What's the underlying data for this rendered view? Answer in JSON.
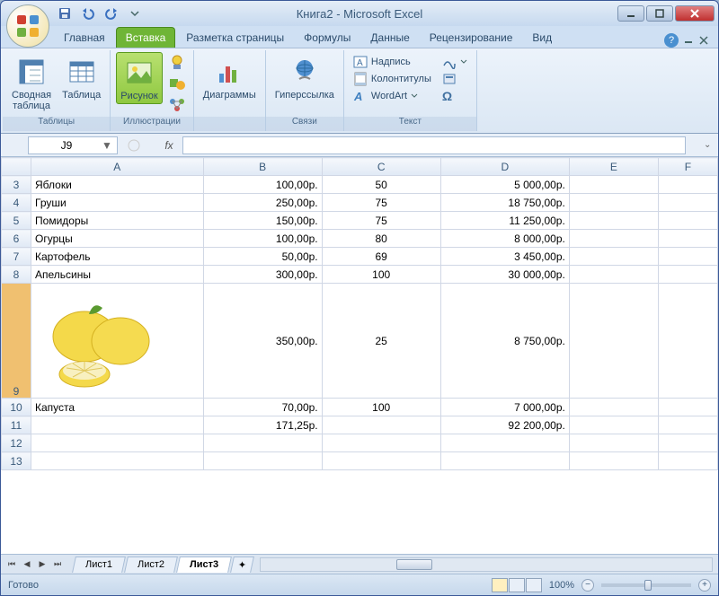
{
  "title": "Книга2 - Microsoft Excel",
  "tabs": {
    "t0": "Главная",
    "t1": "Вставка",
    "t2": "Разметка страницы",
    "t3": "Формулы",
    "t4": "Данные",
    "t5": "Рецензирование",
    "t6": "Вид"
  },
  "ribbon": {
    "pivot": "Сводная\nтаблица",
    "table": "Таблица",
    "picture": "Рисунок",
    "charts": "Диаграммы",
    "hyperlink": "Гиперссылка",
    "textbox": "Надпись",
    "headerfooter": "Колонтитулы",
    "wordart": "WordArt",
    "grp_tables": "Таблицы",
    "grp_illus": "Иллюстрации",
    "grp_links": "Связи",
    "grp_text": "Текст"
  },
  "nameBox": "J9",
  "fx": "fx",
  "cols": {
    "A": "A",
    "B": "B",
    "C": "C",
    "D": "D",
    "E": "E",
    "F": "F"
  },
  "rows": {
    "r3": {
      "n": "3",
      "A": "Яблоки",
      "B": "100,00р.",
      "C": "50",
      "D": "5 000,00р."
    },
    "r4": {
      "n": "4",
      "A": "Груши",
      "B": "250,00р.",
      "C": "75",
      "D": "18 750,00р."
    },
    "r5": {
      "n": "5",
      "A": "Помидоры",
      "B": "150,00р.",
      "C": "75",
      "D": "11 250,00р."
    },
    "r6": {
      "n": "6",
      "A": "Огурцы",
      "B": "100,00р.",
      "C": "80",
      "D": "8 000,00р."
    },
    "r7": {
      "n": "7",
      "A": "Картофель",
      "B": "50,00р.",
      "C": "69",
      "D": "3 450,00р."
    },
    "r8": {
      "n": "8",
      "A": "Апельсины",
      "B": "300,00р.",
      "C": "100",
      "D": "30 000,00р."
    },
    "r9": {
      "n": "9",
      "B": "350,00р.",
      "C": "25",
      "D": "8 750,00р."
    },
    "r10": {
      "n": "10",
      "A": "Капуста",
      "B": "70,00р.",
      "C": "100",
      "D": "7 000,00р."
    },
    "r11": {
      "n": "11",
      "B": "171,25р.",
      "D": "92 200,00р."
    },
    "r12": {
      "n": "12"
    },
    "r13": {
      "n": "13"
    }
  },
  "sheets": {
    "s1": "Лист1",
    "s2": "Лист2",
    "s3": "Лист3"
  },
  "status": "Готово",
  "zoom": "100%"
}
